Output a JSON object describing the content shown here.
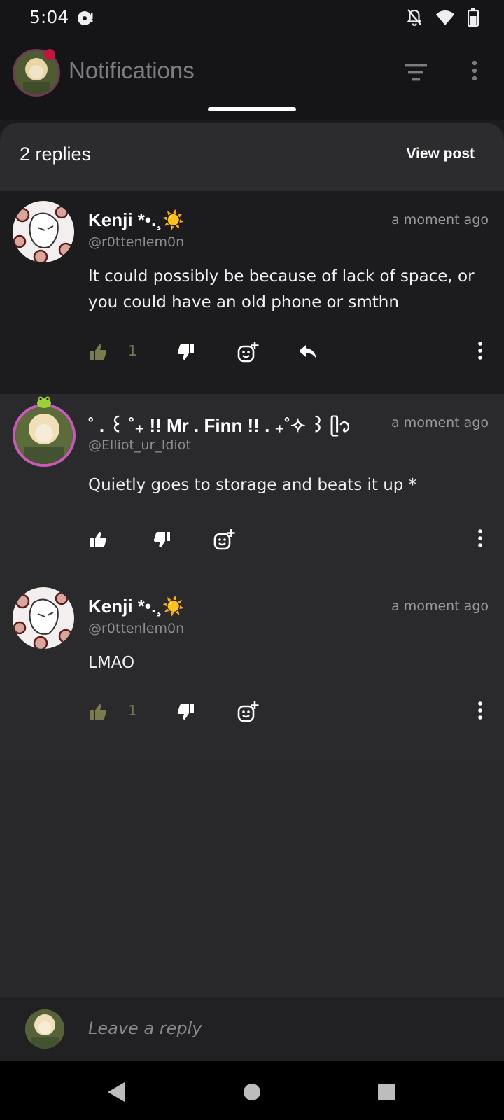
{
  "status_bar": {
    "time": "5:04",
    "icons": [
      "music-disc-icon",
      "notifications-off-icon",
      "wifi-icon",
      "battery-icon"
    ]
  },
  "app_bar": {
    "title": "Notifications",
    "icons": [
      "filter-icon",
      "more-vert-icon"
    ],
    "unread_dot_color": "#c4163a"
  },
  "sheet": {
    "replies_label": "2 replies",
    "view_post_label": "View post"
  },
  "comments": [
    {
      "name": "Kenji *•.¸☀️",
      "handle": "@r0ttenlem0n",
      "time": "a moment ago",
      "text": "It could possibly be because of lack of space, or you could have an old phone or smthn",
      "likes": "1",
      "has_reply_action": true
    },
    {
      "name": "˚ . ꒰ ˚₊ !! Mr . Finn !! .  ₊˚✧ ꒱ ᥫ᭡",
      "handle": "@Elliot_ur_Idiot",
      "time": "a moment ago",
      "text": "Quietly goes to storage and beats it up *",
      "likes": "",
      "has_reply_action": false
    },
    {
      "name": "Kenji *•.¸☀️",
      "handle": "@r0ttenlem0n",
      "time": "a moment ago",
      "text": "LMAO",
      "likes": "1",
      "has_reply_action": false
    }
  ],
  "reply_bar": {
    "placeholder": "Leave a reply"
  },
  "nav_bar": {
    "icons": [
      "back-icon",
      "home-icon",
      "recents-icon"
    ]
  },
  "colors": {
    "liked_thumb": "#7a7a50",
    "avatar_ring": "#c55ab8"
  }
}
